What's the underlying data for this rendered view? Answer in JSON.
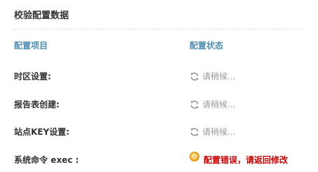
{
  "section": {
    "title": "校验配置数据"
  },
  "columns": {
    "item": "配置项目",
    "status": "配置状态"
  },
  "rows": [
    {
      "label": "时区设置:",
      "status_icon": "refresh-icon",
      "status": "请稍候..."
    },
    {
      "label": "报告表创建:",
      "status_icon": "refresh-icon",
      "status": "请稍候..."
    },
    {
      "label": "站点KEY设置:",
      "status_icon": "refresh-icon",
      "status": "请稍候..."
    },
    {
      "label": "系统命令 exec :",
      "status_icon": "error-icon",
      "status": "配置错误，请返回修改"
    }
  ],
  "colors": {
    "header": "#4f8fb3",
    "pending": "#9a9a9a",
    "error": "#cc0000"
  }
}
